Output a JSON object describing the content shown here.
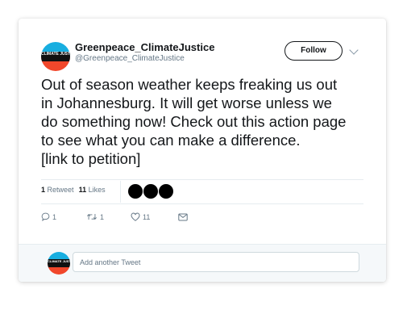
{
  "account": {
    "display_name": "Greenpeace_ClimateJustice",
    "handle": "@Greenpeace_ClimateJustice",
    "avatar_text": "CLIMATE JUSTICE",
    "avatar_colors": [
      "#18aee0",
      "#111111",
      "#f1472b"
    ]
  },
  "follow_label": "Follow",
  "tweet_lines": [
    "Out of season weather keeps freaking us out",
    "in Johannesburg. It will get worse unless we",
    "do something now! Check out this action page",
    "to see what you can make a difference.",
    "[link to petition]"
  ],
  "stats": {
    "retweet_count": "1",
    "retweet_label": "Retweet",
    "like_count": "11",
    "like_label": "Likes",
    "liker_avatar_count": 3
  },
  "actions": {
    "reply_count": "1",
    "retweet_count": "1",
    "like_count": "11"
  },
  "reply_box": {
    "placeholder": "Add another Tweet"
  },
  "colors": {
    "text": "#14171a",
    "muted": "#657786",
    "divider": "#e6ecf0"
  }
}
